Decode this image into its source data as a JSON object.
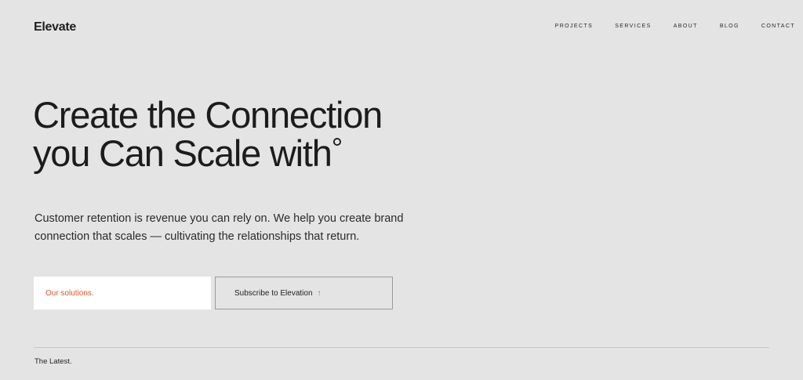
{
  "header": {
    "logo": "Elevate",
    "nav": [
      {
        "label": "PROJECTS"
      },
      {
        "label": "SERVICES"
      },
      {
        "label": "ABOUT"
      },
      {
        "label": "BLOG"
      },
      {
        "label": "CONTACT"
      }
    ]
  },
  "hero": {
    "title_line1": "Create the Connection",
    "title_line2": "you Can Scale with",
    "title_mark": "°",
    "description": "Customer retention is revenue you can rely on. We help you create brand connection that scales — cultivating the relationships that return.",
    "primary_button": "Our solutions.",
    "secondary_button": "Subscribe to Elevation",
    "secondary_button_icon": "↑"
  },
  "latest": {
    "label": "The Latest."
  },
  "colors": {
    "background": "#e4e4e4",
    "accent": "#e0532f",
    "text": "#1f1f1f"
  }
}
